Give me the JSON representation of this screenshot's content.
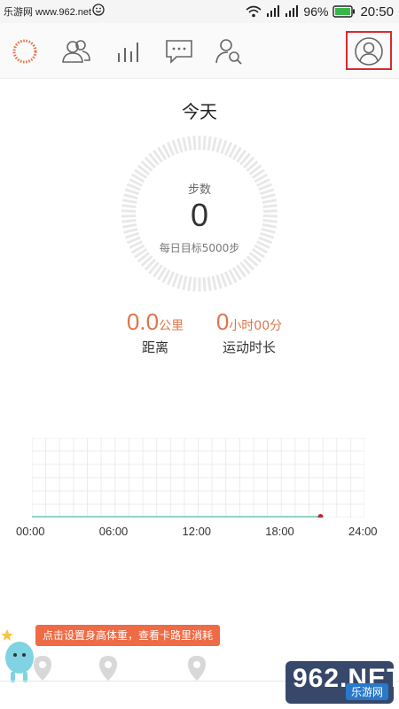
{
  "status_bar": {
    "watermark": "乐游网 www.962.net",
    "battery": "96%",
    "time": "20:50"
  },
  "tabs": [
    {
      "name": "steps-ring-tab",
      "icon": "steps-ring-icon"
    },
    {
      "name": "friends-tab",
      "icon": "people-icon"
    },
    {
      "name": "ranking-tab",
      "icon": "bar-chart-icon"
    },
    {
      "name": "messages-tab",
      "icon": "chat-bubble-icon"
    },
    {
      "name": "find-friend-tab",
      "icon": "person-search-icon"
    },
    {
      "name": "profile-tab",
      "icon": "profile-avatar-icon"
    }
  ],
  "today": {
    "title": "今天",
    "steps_label": "步数",
    "steps_value": "0",
    "goal": "每日目标5000步",
    "progress": 0
  },
  "metrics": {
    "distance_value": "0.0",
    "distance_unit": "公里",
    "distance_label": "距离",
    "duration_value": "0",
    "duration_unit": "小时00分",
    "duration_label": "运动时长"
  },
  "chart_data": {
    "type": "line",
    "x": [
      "00:00",
      "06:00",
      "12:00",
      "18:00",
      "24:00"
    ],
    "series": [
      {
        "values": [
          0,
          0,
          0,
          0
        ]
      }
    ],
    "current_time": "20:50"
  },
  "bottom": {
    "hint": "点击设置身高体重，查看卡路里消耗",
    "watermark_brand": "962.NET",
    "watermark_sub": "乐游网"
  },
  "colors": {
    "accent": "#e0754a",
    "highlight_border": "#d9292c",
    "ring": "#e8e8e8",
    "baseline": "#8fd3c8",
    "current_dot": "#c0282a"
  }
}
